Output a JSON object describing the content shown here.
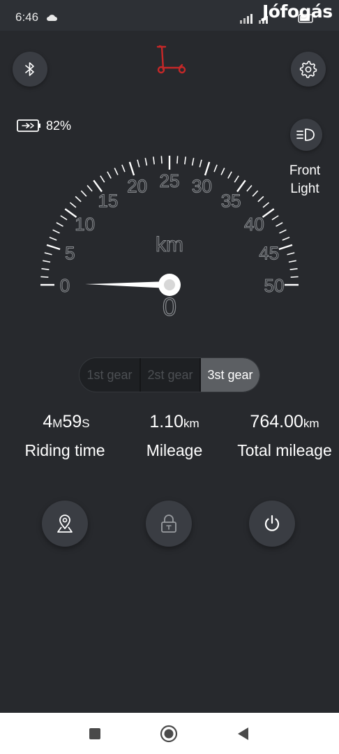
{
  "status_bar": {
    "time": "6:46",
    "watermark": "Jófogás"
  },
  "battery": {
    "percent_text": "82%",
    "level": 0.82
  },
  "front_light": {
    "label_line1": "Front",
    "label_line2": "Light"
  },
  "speedometer": {
    "unit": "km",
    "current_speed": "0",
    "min": 0,
    "max": 50,
    "tick_labels": [
      "0",
      "5",
      "10",
      "15",
      "20",
      "25",
      "30",
      "35",
      "40",
      "45",
      "50"
    ]
  },
  "gears": [
    {
      "label": "1st gear",
      "active": false
    },
    {
      "label": "2st gear",
      "active": false
    },
    {
      "label": "3st gear",
      "active": true
    }
  ],
  "stats": {
    "riding_time": {
      "h": "4",
      "m_unit": "M",
      "s": "59",
      "s_unit": "S",
      "label": "Riding time"
    },
    "mileage": {
      "value": "1.10",
      "unit": "km",
      "label": "Mileage"
    },
    "total_mileage": {
      "value": "764.00",
      "unit": "km",
      "label": "Total mileage"
    }
  },
  "colors": {
    "background": "#27292d",
    "button": "#3a3d43",
    "scooter_accent": "#c62828",
    "gear_active": "#5c5f63"
  },
  "icons": [
    "bluetooth-icon",
    "scooter-icon",
    "gear-icon",
    "battery-charging-icon",
    "headlight-icon",
    "map-pin-icon",
    "lock-icon",
    "power-icon",
    "nav-square-icon",
    "nav-circle-icon",
    "nav-back-icon"
  ]
}
